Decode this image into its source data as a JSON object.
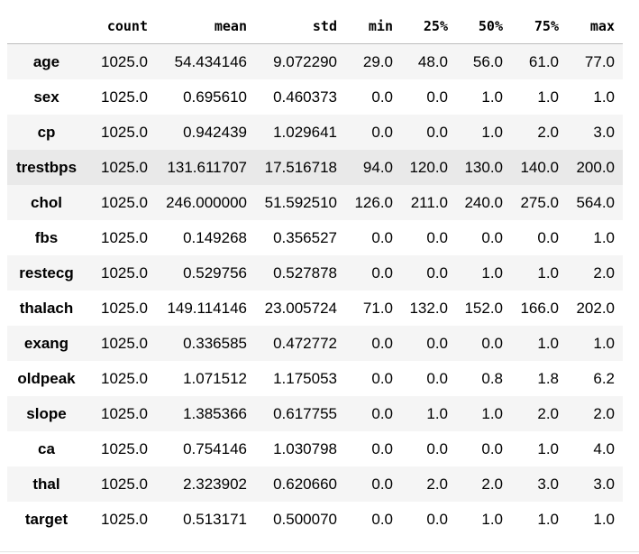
{
  "table": {
    "columns": [
      "count",
      "mean",
      "std",
      "min",
      "25%",
      "50%",
      "75%",
      "max"
    ],
    "rows": [
      {
        "label": "age",
        "values": [
          "1025.0",
          "54.434146",
          "9.072290",
          "29.0",
          "48.0",
          "56.0",
          "61.0",
          "77.0"
        ]
      },
      {
        "label": "sex",
        "values": [
          "1025.0",
          "0.695610",
          "0.460373",
          "0.0",
          "0.0",
          "1.0",
          "1.0",
          "1.0"
        ]
      },
      {
        "label": "cp",
        "values": [
          "1025.0",
          "0.942439",
          "1.029641",
          "0.0",
          "0.0",
          "1.0",
          "2.0",
          "3.0"
        ]
      },
      {
        "label": "trestbps",
        "values": [
          "1025.0",
          "131.611707",
          "17.516718",
          "94.0",
          "120.0",
          "130.0",
          "140.0",
          "200.0"
        ]
      },
      {
        "label": "chol",
        "values": [
          "1025.0",
          "246.000000",
          "51.592510",
          "126.0",
          "211.0",
          "240.0",
          "275.0",
          "564.0"
        ]
      },
      {
        "label": "fbs",
        "values": [
          "1025.0",
          "0.149268",
          "0.356527",
          "0.0",
          "0.0",
          "0.0",
          "0.0",
          "1.0"
        ]
      },
      {
        "label": "restecg",
        "values": [
          "1025.0",
          "0.529756",
          "0.527878",
          "0.0",
          "0.0",
          "1.0",
          "1.0",
          "2.0"
        ]
      },
      {
        "label": "thalach",
        "values": [
          "1025.0",
          "149.114146",
          "23.005724",
          "71.0",
          "132.0",
          "152.0",
          "166.0",
          "202.0"
        ]
      },
      {
        "label": "exang",
        "values": [
          "1025.0",
          "0.336585",
          "0.472772",
          "0.0",
          "0.0",
          "0.0",
          "1.0",
          "1.0"
        ]
      },
      {
        "label": "oldpeak",
        "values": [
          "1025.0",
          "1.071512",
          "1.175053",
          "0.0",
          "0.0",
          "0.8",
          "1.8",
          "6.2"
        ]
      },
      {
        "label": "slope",
        "values": [
          "1025.0",
          "1.385366",
          "0.617755",
          "0.0",
          "1.0",
          "1.0",
          "2.0",
          "2.0"
        ]
      },
      {
        "label": "ca",
        "values": [
          "1025.0",
          "0.754146",
          "1.030798",
          "0.0",
          "0.0",
          "0.0",
          "1.0",
          "4.0"
        ]
      },
      {
        "label": "thal",
        "values": [
          "1025.0",
          "2.323902",
          "0.620660",
          "0.0",
          "2.0",
          "2.0",
          "3.0",
          "3.0"
        ]
      },
      {
        "label": "target",
        "values": [
          "1025.0",
          "0.513171",
          "0.500070",
          "0.0",
          "0.0",
          "1.0",
          "1.0",
          "1.0"
        ]
      }
    ]
  }
}
